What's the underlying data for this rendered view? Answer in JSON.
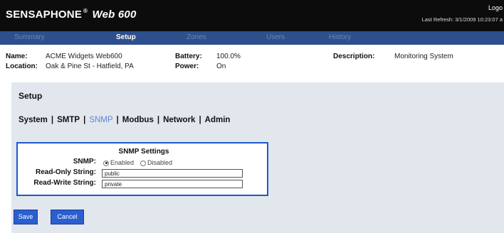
{
  "header": {
    "brand": "SENSAPHONE",
    "registered": "®",
    "model": "Web 600",
    "login": "Logo",
    "last_refresh": "Last Refresh: 3/1/2009 10:23:07 a"
  },
  "nav": {
    "tabs": [
      {
        "label": "Summary",
        "active": false
      },
      {
        "label": "Setup",
        "active": true
      },
      {
        "label": "Zones",
        "active": false
      },
      {
        "label": "Users",
        "active": false
      },
      {
        "label": "History",
        "active": false
      }
    ]
  },
  "device_info": {
    "name_label": "Name:",
    "name_value": "ACME Widgets Web600",
    "location_label": "Location:",
    "location_value": "Oak & Pine St - Hatfield, PA",
    "battery_label": "Battery:",
    "battery_value": "100.0%",
    "power_label": "Power:",
    "power_value": "On",
    "description_label": "Description:",
    "description_value": "Monitoring System"
  },
  "setup": {
    "title": "Setup",
    "subtabs": [
      "System",
      "SMTP",
      "SNMP",
      "Modbus",
      "Network",
      "Admin"
    ],
    "selected_subtab": "SNMP",
    "separator": "|"
  },
  "snmp_settings": {
    "title": "SNMP Settings",
    "snmp_label": "SNMP:",
    "enabled_label": "Enabled",
    "disabled_label": "Disabled",
    "selected": "Enabled",
    "read_only_label": "Read-Only String:",
    "read_only_value": "public",
    "read_write_label": "Read-Write String:",
    "read_write_value": "private"
  },
  "buttons": {
    "save": "Save",
    "cancel": "Cancel"
  },
  "colors": {
    "titlebar": "#0c0c0c",
    "navbar": "#2d4f8c",
    "panel": "#e2e7ee",
    "settings_border": "#1e58c8",
    "button": "#2b5fd0"
  }
}
